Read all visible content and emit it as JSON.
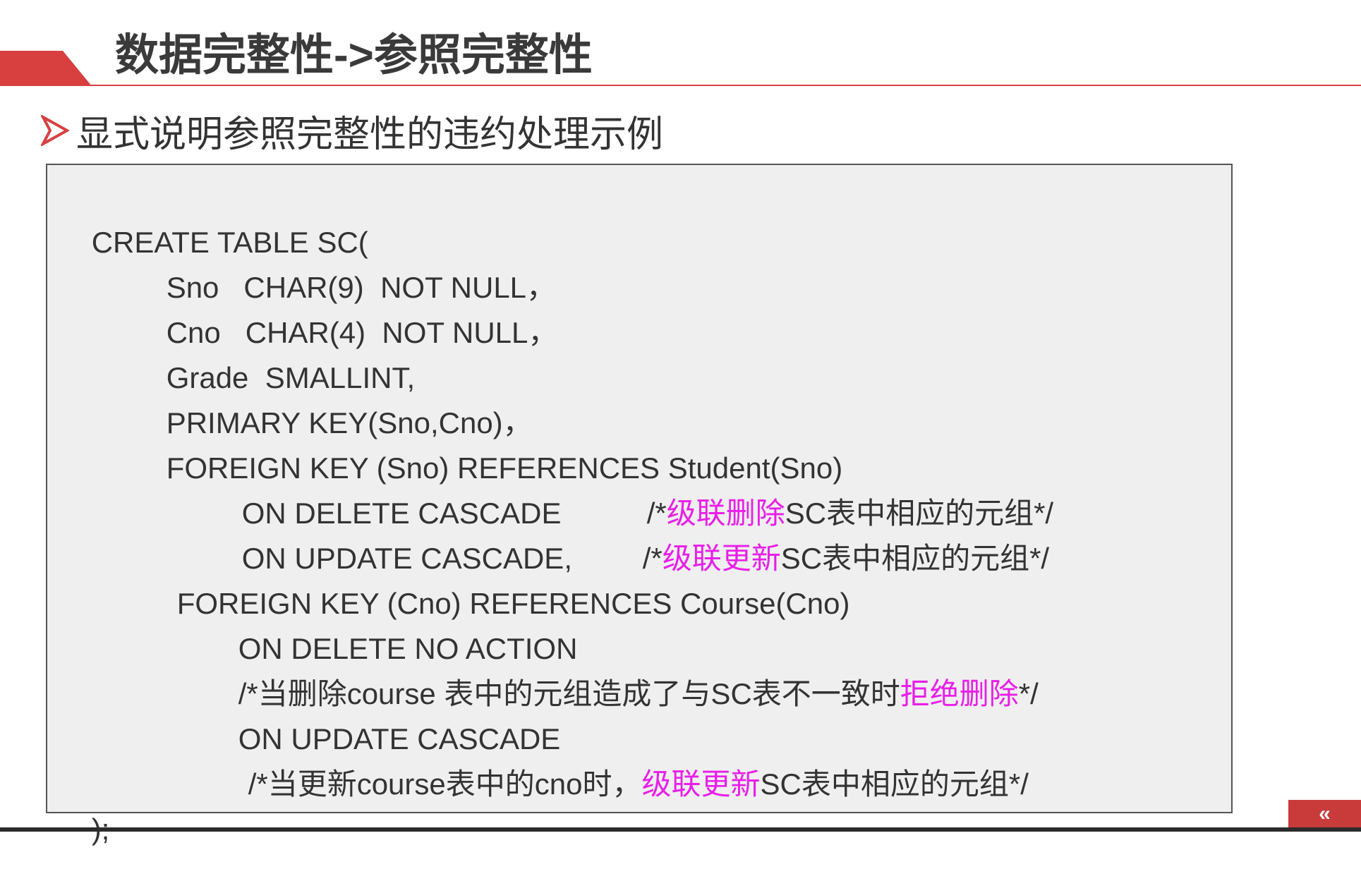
{
  "header": {
    "title": "数据完整性->参照完整性"
  },
  "subtitle": {
    "text": "显式说明参照完整性的违约处理示例",
    "bullet_icon": "right-triangle-arrow-icon"
  },
  "code_lines": [
    {
      "id": "create-table",
      "parts": [
        "CREATE TABLE SC("
      ]
    },
    {
      "id": "sno-column",
      "parts": [
        "Sno   CHAR(9)  NOT NULL，"
      ]
    },
    {
      "id": "cno-column",
      "parts": [
        "Cno   CHAR(4)  NOT NULL，"
      ]
    },
    {
      "id": "grade-column",
      "parts": [
        "Grade  SMALLINT,"
      ]
    },
    {
      "id": "primary-key",
      "parts": [
        "PRIMARY KEY(Sno,Cno)，"
      ]
    },
    {
      "id": "fk-student",
      "parts": [
        "FOREIGN KEY (Sno) REFERENCES Student(Sno)"
      ]
    },
    {
      "id": "on-delete-cascade",
      "parts": [
        "ON DELETE CASCADE",
        "/*",
        "级联删除",
        "SC表中相应的元组*/"
      ]
    },
    {
      "id": "on-update-cascade",
      "parts": [
        "ON UPDATE CASCADE,",
        "/*",
        "级联更新",
        "SC表中相应的元组*/"
      ]
    },
    {
      "id": "fk-course",
      "parts": [
        "FOREIGN KEY (Cno) REFERENCES Course(Cno)"
      ]
    },
    {
      "id": "on-delete-no-action",
      "parts": [
        "ON DELETE NO ACTION"
      ]
    },
    {
      "id": "comment-reject-delete",
      "parts": [
        "/*当删除course 表中的元组造成了与SC表不一致时",
        "拒绝删除",
        "*/"
      ]
    },
    {
      "id": "on-update-cascade-2",
      "parts": [
        "ON UPDATE CASCADE"
      ]
    },
    {
      "id": "comment-cascade-update",
      "parts": [
        "/*当更新course表中的cno时，",
        "级联更新",
        "SC表中相应的元组*/"
      ]
    },
    {
      "id": "close-paren",
      "parts": [
        ");"
      ]
    }
  ],
  "colors": {
    "accent_red": "#d84040",
    "highlight_magenta": "#e81ee8",
    "code_background": "#efefef",
    "text": "#333333"
  },
  "navigation": {
    "prev_icon": "double-chevron-left-icon",
    "prev_glyph": "«"
  }
}
